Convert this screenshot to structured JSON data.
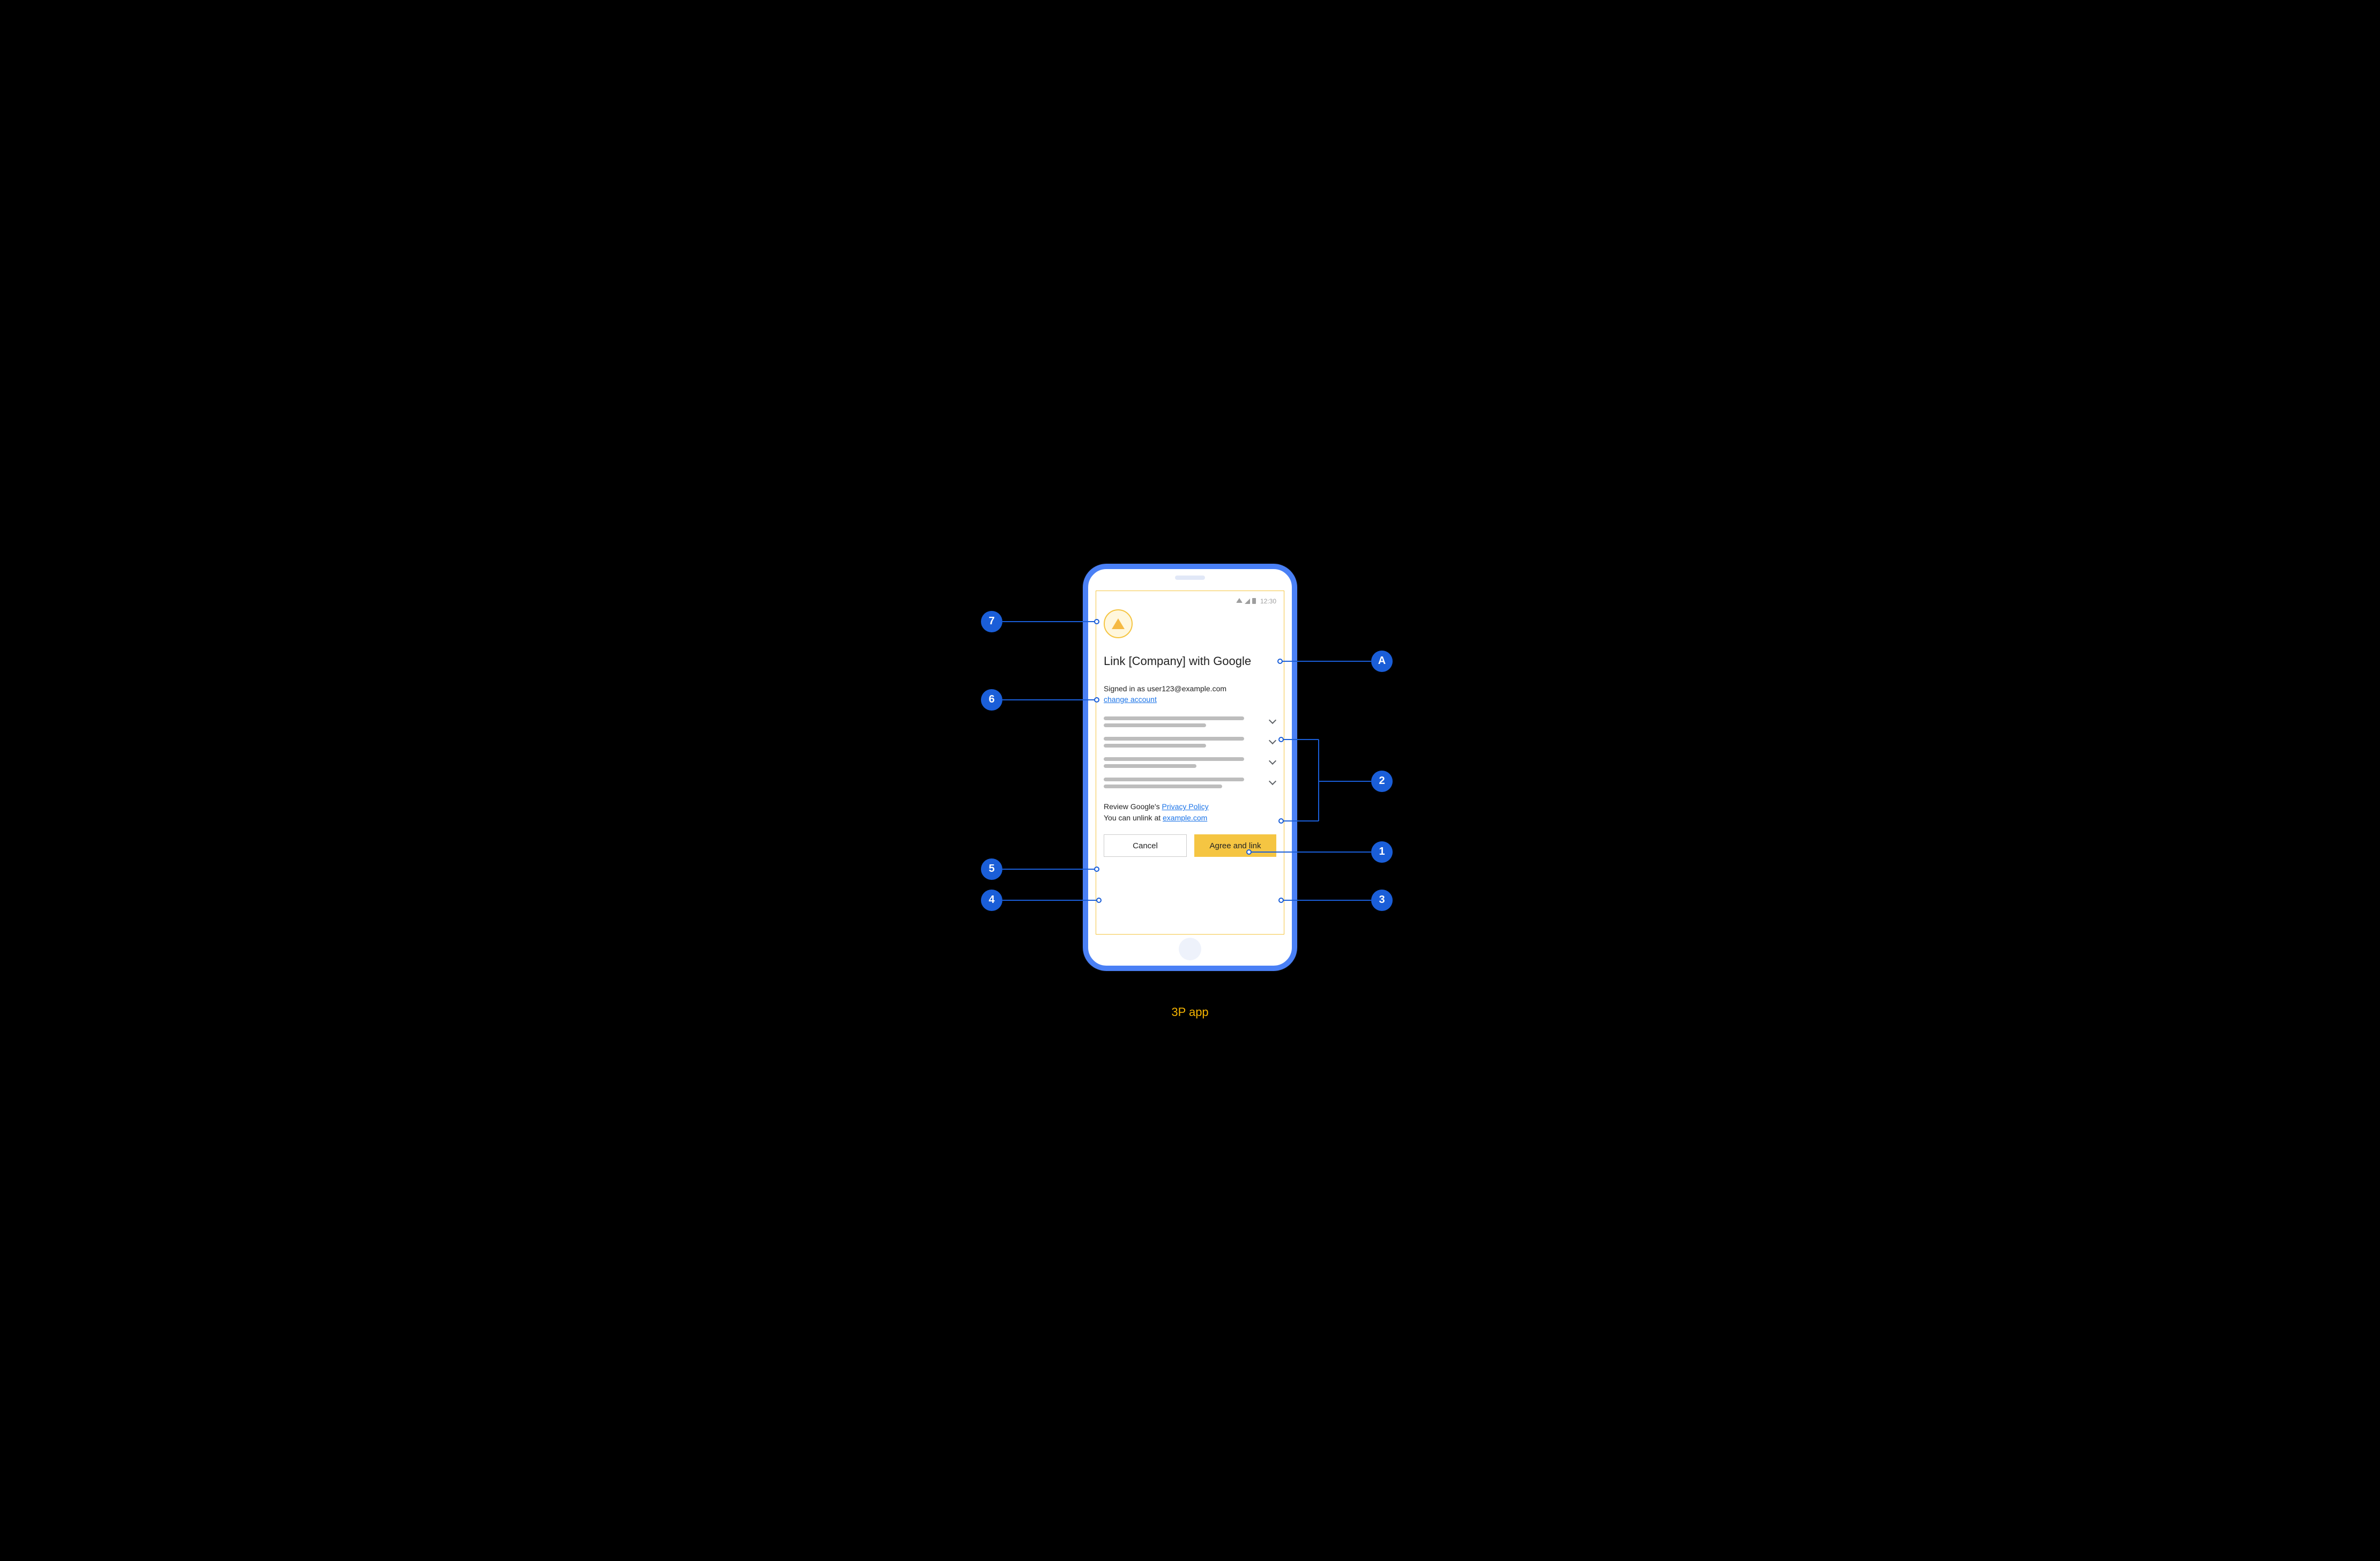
{
  "caption": "3P app",
  "status": {
    "time": "12:30"
  },
  "headline": "Link [Company] with Google",
  "account": {
    "signed_in_prefix": "Signed in as ",
    "email": "user123@example.com",
    "change_label": "change account"
  },
  "privacy": {
    "prefix": "Review Google's ",
    "link_label": "Privacy Policy"
  },
  "unlink": {
    "prefix": "You can unlink at ",
    "link_label": "example.com"
  },
  "buttons": {
    "cancel": "Cancel",
    "agree": "Agree and link"
  },
  "callouts": {
    "c1": "1",
    "c2": "2",
    "c3": "3",
    "c4": "4",
    "c5": "5",
    "c6": "6",
    "c7": "7",
    "cA": "A"
  }
}
